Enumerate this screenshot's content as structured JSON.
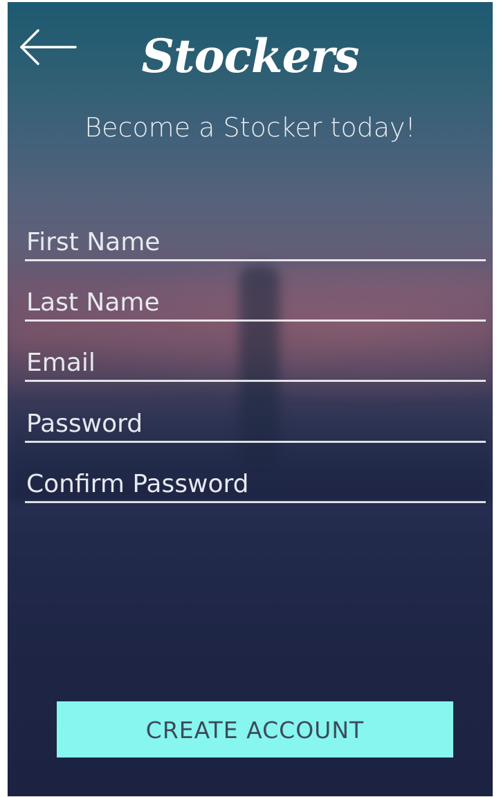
{
  "header": {
    "back_icon": "arrow-left-icon",
    "brand": "Stockers",
    "subtitle": "Become a Stocker today!"
  },
  "form": {
    "first_name": {
      "placeholder": "First Name",
      "value": ""
    },
    "last_name": {
      "placeholder": "Last Name",
      "value": ""
    },
    "email": {
      "placeholder": "Email",
      "value": ""
    },
    "password": {
      "placeholder": "Password",
      "value": ""
    },
    "confirm_password": {
      "placeholder": "Confirm Password",
      "value": ""
    }
  },
  "actions": {
    "create_account_label": "CREATE ACCOUNT"
  },
  "colors": {
    "accent": "#86f6ee",
    "button_text": "#3d4a5a",
    "text": "#ffffff",
    "background_top": "#1d5a72",
    "background_bottom": "#1c2242"
  }
}
